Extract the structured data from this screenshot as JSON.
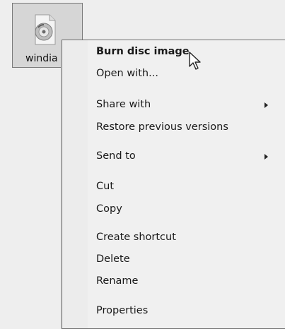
{
  "desktop": {
    "file_label": "windia",
    "file_icon": "disc-image-icon"
  },
  "context_menu": {
    "items": [
      {
        "label": "Burn disc image",
        "bold": true
      },
      {
        "label": "Open with..."
      },
      {
        "label": "Share with",
        "submenu": true
      },
      {
        "label": "Restore previous versions"
      },
      {
        "label": "Send to",
        "submenu": true
      },
      {
        "label": "Cut"
      },
      {
        "label": "Copy"
      },
      {
        "label": "Create shortcut"
      },
      {
        "label": "Delete"
      },
      {
        "label": "Rename"
      },
      {
        "label": "Properties"
      }
    ]
  },
  "cursor": {
    "icon": "arrow-pointer-icon"
  }
}
